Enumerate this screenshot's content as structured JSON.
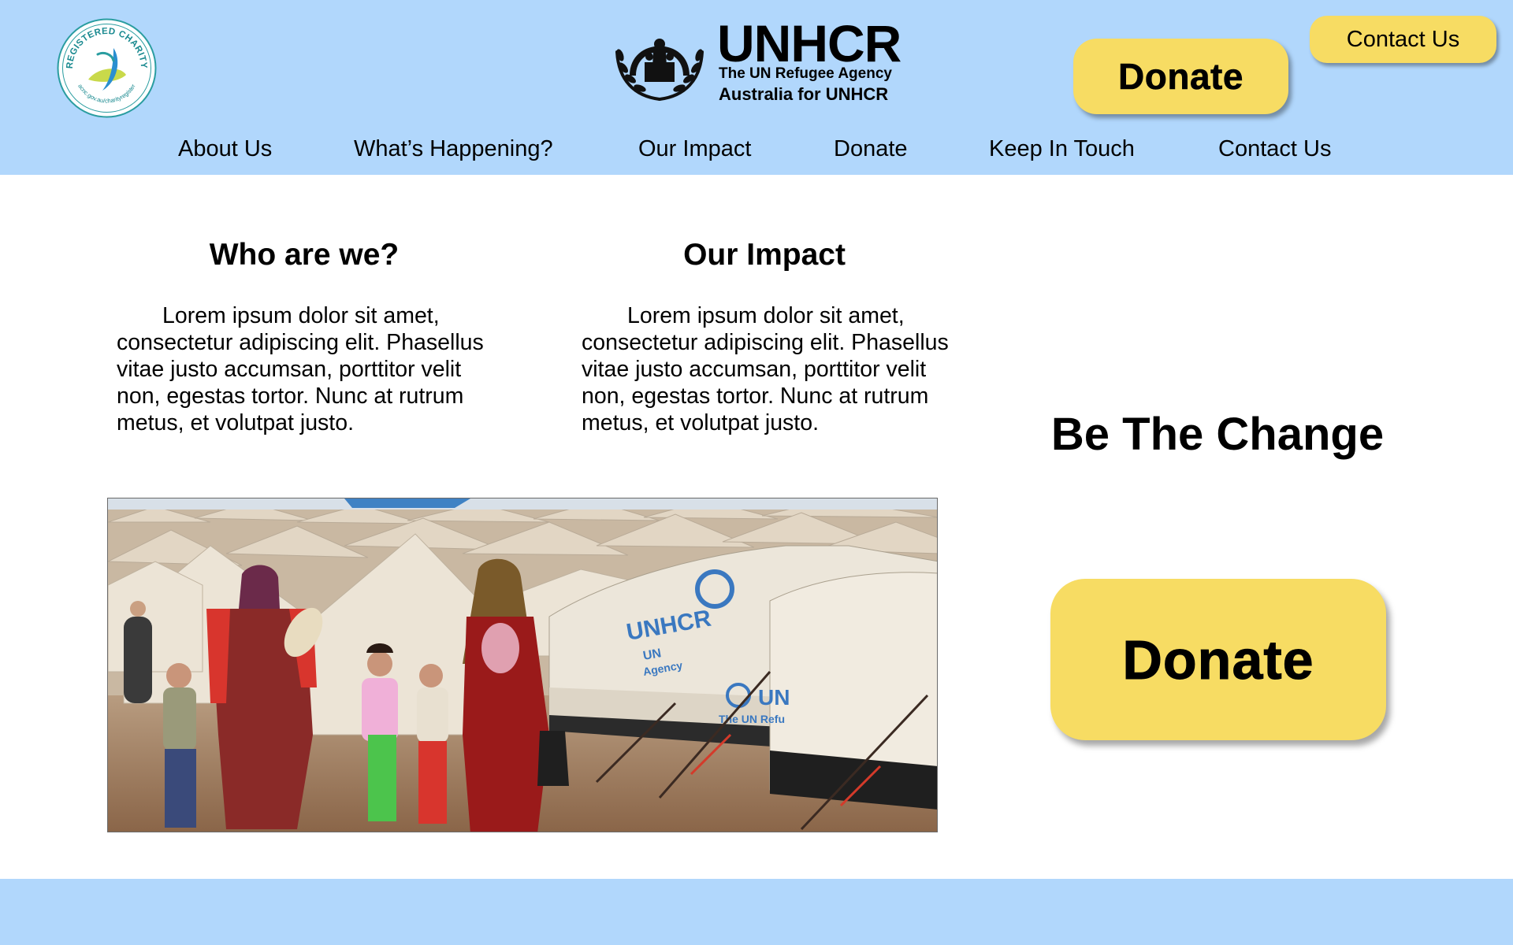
{
  "header": {
    "charity_badge": {
      "text_top": "REGISTERED CHARITY",
      "text_bottom": "acnc.gov.au/charityregister",
      "icon": "registered-charity-icon"
    },
    "brand": {
      "name": "UNHCR",
      "tagline": "The UN Refugee Agency",
      "subtitle": "Australia for UNHCR",
      "icon": "unhcr-emblem-icon"
    },
    "contact_button": "Contact Us",
    "donate_button": "Donate"
  },
  "nav": {
    "items": [
      {
        "label": "About Us"
      },
      {
        "label": "What’s Happening?"
      },
      {
        "label": "Our Impact"
      },
      {
        "label": "Donate"
      },
      {
        "label": "Keep In Touch"
      },
      {
        "label": "Contact Us"
      }
    ]
  },
  "main": {
    "columns": [
      {
        "heading": "Who are we?",
        "body": "Lorem ipsum dolor sit amet, consectetur adipiscing elit. Phasellus vitae justo accumsan, porttitor velit non, egestas tortor. Nunc at rutrum metus, et volutpat justo."
      },
      {
        "heading": "Our Impact",
        "body": "Lorem ipsum dolor sit amet, consectetur adipiscing elit. Phasellus vitae justo accumsan, porttitor velit non, egestas tortor. Nunc at rutrum metus, et volutpat justo."
      }
    ],
    "photo": {
      "tent_label": "UNHCR",
      "tent_label_sub": "UN",
      "tent_label_sub2": "Agency",
      "tent_label2": "UN",
      "tent_label2_sub": "The UN Refu"
    },
    "tagline": "Be The Change",
    "donate_button": "Donate"
  },
  "colors": {
    "header_bg": "#b1d7fc",
    "button_bg": "#f7dc63",
    "page_bg": "#ffffff"
  }
}
